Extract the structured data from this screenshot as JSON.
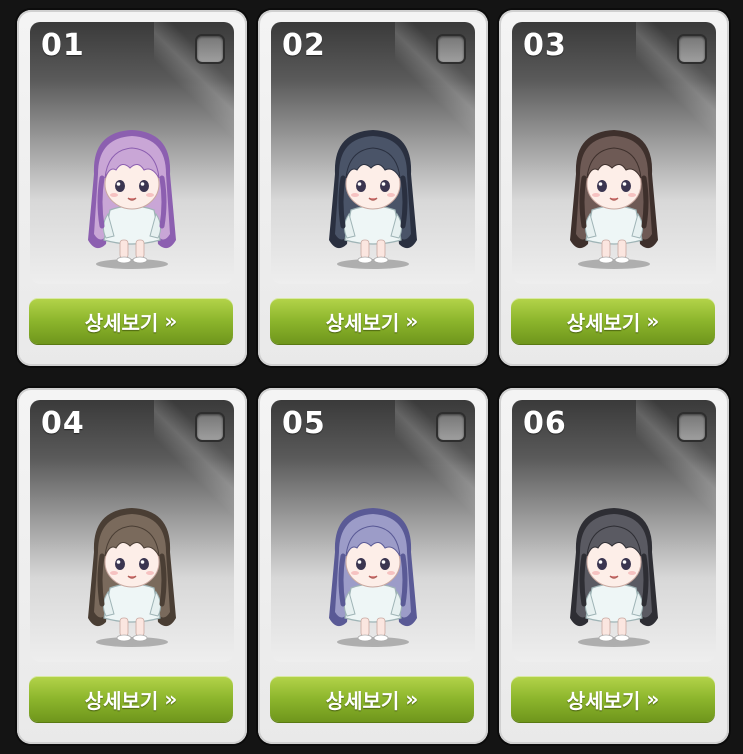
{
  "colors": {
    "button_green": "#8cb52c",
    "card_bg": "#efefef",
    "panel_top": "#3a3a3a"
  },
  "cards": [
    {
      "number": "01",
      "button_label": "상세보기",
      "button_icon": "double-chevron-right-icon",
      "hair": "#c9a6d6",
      "hair_dark": "#8c5fb0",
      "checked": false
    },
    {
      "number": "02",
      "button_label": "상세보기",
      "button_icon": "double-chevron-right-icon",
      "hair": "#4a5468",
      "hair_dark": "#2a3040",
      "checked": false
    },
    {
      "number": "03",
      "button_label": "상세보기",
      "button_icon": "double-chevron-right-icon",
      "hair": "#6e5a55",
      "hair_dark": "#3e302c",
      "checked": false
    },
    {
      "number": "04",
      "button_label": "상세보기",
      "button_icon": "double-chevron-right-icon",
      "hair": "#7a6a5c",
      "hair_dark": "#4a3e34",
      "checked": false
    },
    {
      "number": "05",
      "button_label": "상세보기",
      "button_icon": "double-chevron-right-icon",
      "hair": "#9c9cc8",
      "hair_dark": "#5a5a96",
      "checked": false
    },
    {
      "number": "06",
      "button_label": "상세보기",
      "button_icon": "double-chevron-right-icon",
      "hair": "#5a5a62",
      "hair_dark": "#2e2e34",
      "checked": false
    }
  ]
}
